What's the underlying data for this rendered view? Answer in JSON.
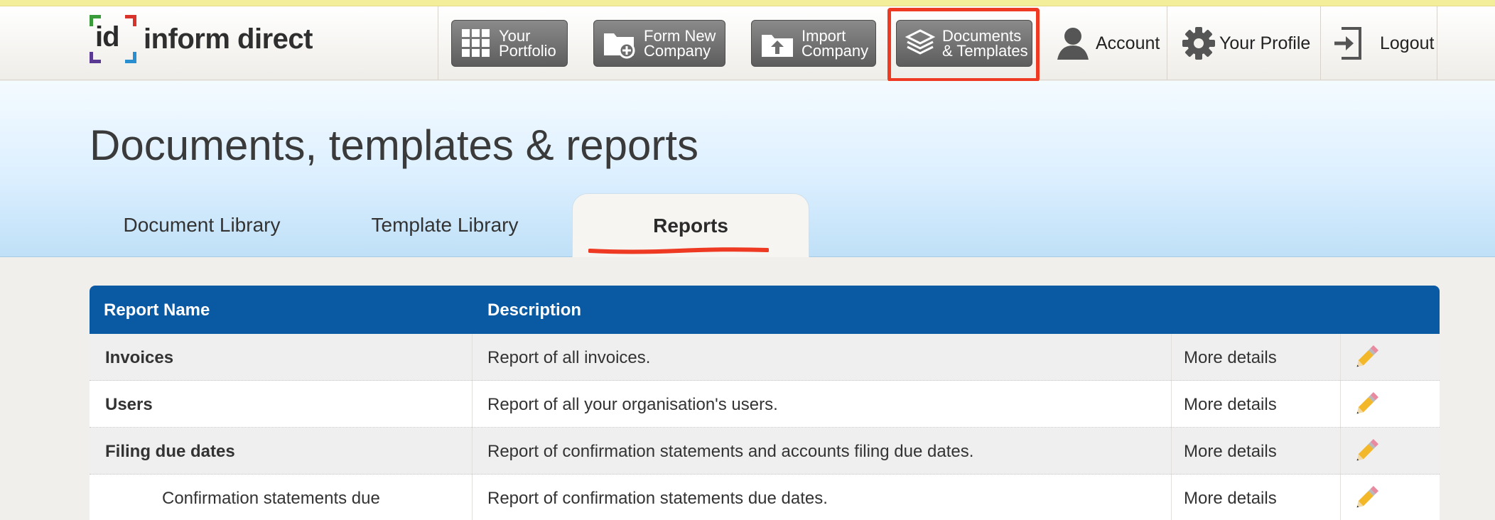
{
  "brand": {
    "logo_mark": "id",
    "logo_text": "inform direct"
  },
  "nav": {
    "buttons": [
      {
        "label": "Your\nPortfolio",
        "icon": "grid-icon"
      },
      {
        "label": "Form New\nCompany",
        "icon": "folder-plus-icon"
      },
      {
        "label": "Import\nCompany",
        "icon": "upload-folder-icon"
      },
      {
        "label": "Documents\n& Templates",
        "icon": "layers-icon"
      }
    ],
    "links": [
      {
        "label": "Account",
        "icon": "user-icon"
      },
      {
        "label": "Your Profile",
        "icon": "gear-icon"
      },
      {
        "label": "Logout",
        "icon": "logout-icon"
      }
    ]
  },
  "page": {
    "title": "Documents, templates & reports"
  },
  "tabs": [
    {
      "label": "Document Library"
    },
    {
      "label": "Template Library"
    },
    {
      "label": "Reports",
      "active": true
    }
  ],
  "table": {
    "headers": {
      "name": "Report Name",
      "description": "Description"
    },
    "rows": [
      {
        "name": "Invoices",
        "description": "Report of all invoices.",
        "action": "More details"
      },
      {
        "name": "Users",
        "description": "Report of all your organisation's users.",
        "action": "More details"
      },
      {
        "name": "Filing due dates",
        "description": "Report of confirmation statements and accounts filing due dates.",
        "action": "More details"
      },
      {
        "name": "Confirmation statements due",
        "description": "Report of confirmation statements due dates.",
        "action": "More details"
      }
    ]
  },
  "colors": {
    "header_blue": "#0a59a3",
    "annotation_red": "#ee3a22",
    "button_gray": "#6d6d6d"
  }
}
